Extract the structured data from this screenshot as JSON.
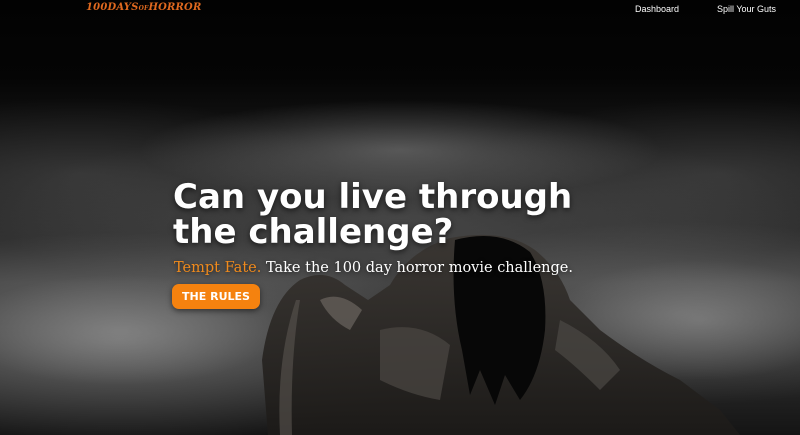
{
  "nav": {
    "logo_main": "100DAYS",
    "logo_small": "OF",
    "logo_end": "HORROR",
    "links": [
      {
        "label": "Dashboard"
      },
      {
        "label": "Spill Your Guts"
      }
    ]
  },
  "hero": {
    "headline": "Can you live through the challenge?",
    "tagline_accent": "Tempt Fate.",
    "tagline_rest": " Take the 100 day horror movie challenge.",
    "cta_label": "THE RULES"
  },
  "colors": {
    "accent": "#f5820f",
    "logo": "#e0691f"
  }
}
